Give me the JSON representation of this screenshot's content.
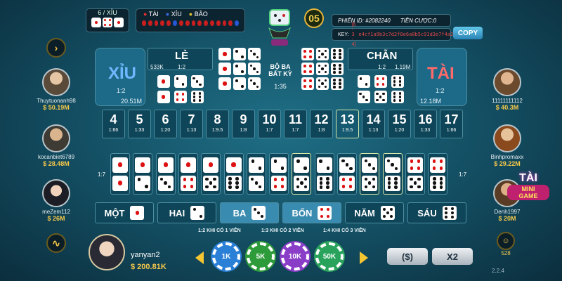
{
  "top": {
    "prev_label": "6 / XỈU",
    "prev_dice": [
      1,
      4,
      1
    ],
    "legend": {
      "tai": "TÀI",
      "xiu": "XỈU",
      "bao": "BÃO"
    },
    "history": [
      "r",
      "r",
      "r",
      "r",
      "r",
      "b",
      "r",
      "r",
      "r",
      "r",
      "r",
      "r",
      "r",
      "r",
      "r",
      "b"
    ],
    "timer": "05",
    "session_label": "PHIÊN ID:",
    "session_id": "#2082240",
    "bet_label": "TIỀN CƯỢC:",
    "bet_value": "0",
    "key_label": "KEY:",
    "key_value": "[6 - 3 - 4]",
    "key_hash": "e4cf1a9b3c7d2f8e6a0b5c91d3e7f4a2",
    "copy_label": "COPY"
  },
  "left_players": [
    {
      "name": "Thuytuonanh98",
      "money": "$ 50.19M"
    },
    {
      "name": "kocanbiet6789",
      "money": "$ 28.48M"
    },
    {
      "name": "meZem112",
      "money": "$ 26M"
    }
  ],
  "right_players": [
    {
      "name": "11111111112",
      "money": "$ 40.3M"
    },
    {
      "name": "Binhpromaxx",
      "money": "$ 29.22M"
    },
    {
      "name": "Denh1997",
      "money": "$ 20M"
    }
  ],
  "board": {
    "xiu": {
      "label": "XỈU",
      "odds": "1:2",
      "amount": "20.51M"
    },
    "tai": {
      "label": "TÀI",
      "odds": "1:2",
      "amount": "12.18M"
    },
    "le": {
      "label": "LẺ",
      "amount": "533K",
      "odds": "1:2"
    },
    "chan": {
      "label": "CHẴN",
      "odds": "1:2",
      "amount": "1.19M"
    },
    "triple": {
      "line1": "BỘ BA",
      "line2": "BẤT KỲ",
      "odds": "1:35"
    },
    "sums": [
      {
        "n": "4",
        "p": "1:66"
      },
      {
        "n": "5",
        "p": "1:33"
      },
      {
        "n": "6",
        "p": "1:20"
      },
      {
        "n": "7",
        "p": "1:13"
      },
      {
        "n": "8",
        "p": "1:9.5"
      },
      {
        "n": "9",
        "p": "1:8"
      },
      {
        "n": "10",
        "p": "1:7"
      },
      {
        "n": "11",
        "p": "1:7"
      },
      {
        "n": "12",
        "p": "1:8"
      },
      {
        "n": "13",
        "p": "1:9.5"
      },
      {
        "n": "14",
        "p": "1:13"
      },
      {
        "n": "15",
        "p": "1:20"
      },
      {
        "n": "16",
        "p": "1:33"
      },
      {
        "n": "17",
        "p": "1:66"
      }
    ],
    "pair_odds_left": "1:7",
    "pair_odds_right": "1:7",
    "singles": [
      {
        "label": "MỘT",
        "face": 1
      },
      {
        "label": "HAI",
        "face": 2
      },
      {
        "label": "BA",
        "face": 3
      },
      {
        "label": "BỐN",
        "face": 4
      },
      {
        "label": "NĂM",
        "face": 5
      },
      {
        "label": "SÁU",
        "face": 6
      }
    ],
    "notes": [
      {
        "odds": "1:2",
        "text": "KHI CÓ 1 VIÊN"
      },
      {
        "odds": "1:3",
        "text": "KHI CÓ 2 VIÊN"
      },
      {
        "odds": "1:4",
        "text": "KHI CÓ 3 VIÊN"
      }
    ]
  },
  "me": {
    "name": "yanyan2",
    "money": "$ 200.81K"
  },
  "chips": [
    {
      "label": "1K",
      "color": "#2a7fd6"
    },
    {
      "label": "5K",
      "color": "#2e9b3a"
    },
    {
      "label": "10K",
      "color": "#8a3ec8"
    },
    {
      "label": "50K",
      "color": "#29a35c"
    }
  ],
  "buttons": {
    "rebet": "($)",
    "double": "X2"
  },
  "mini_game": {
    "line1": "TÀI",
    "line2": "MINI",
    "line3": "GAME"
  },
  "online_count": "528",
  "version": "2.2.4"
}
